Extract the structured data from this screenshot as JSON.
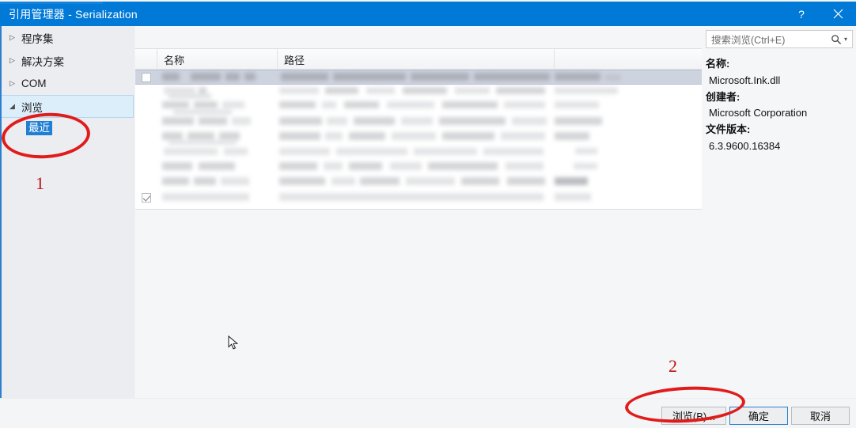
{
  "window": {
    "title": "引用管理器 - Serialization",
    "help_label": "?",
    "close_label": "✕"
  },
  "sidebar": {
    "items": [
      {
        "label": "程序集",
        "glyph": "▷",
        "expanded": false,
        "selected": false
      },
      {
        "label": "解决方案",
        "glyph": "▷",
        "expanded": false,
        "selected": false
      },
      {
        "label": "COM",
        "glyph": "▷",
        "expanded": false,
        "selected": false
      },
      {
        "label": "浏览",
        "glyph": "◢",
        "expanded": true,
        "selected": true
      }
    ],
    "child": {
      "label": "最近",
      "selected": true
    }
  },
  "list": {
    "columns": [
      {
        "key": "checkbox",
        "label": ""
      },
      {
        "key": "name",
        "label": "名称"
      },
      {
        "key": "path",
        "label": "路径"
      },
      {
        "key": "extra",
        "label": ""
      }
    ],
    "rows": [
      {
        "checked": false,
        "selected": true,
        "redacted": true
      },
      {
        "checked": false,
        "selected": false,
        "redacted": true
      },
      {
        "checked": false,
        "selected": false,
        "redacted": true
      },
      {
        "checked": false,
        "selected": false,
        "redacted": true
      },
      {
        "checked": false,
        "selected": false,
        "redacted": true
      },
      {
        "checked": false,
        "selected": false,
        "redacted": true
      },
      {
        "checked": false,
        "selected": false,
        "redacted": true
      },
      {
        "checked": false,
        "selected": false,
        "redacted": true
      },
      {
        "checked": true,
        "selected": false,
        "redacted": true
      }
    ]
  },
  "search": {
    "placeholder": "搜索浏览(Ctrl+E)",
    "icon": "search-icon",
    "dropdown_caret": "▾"
  },
  "details": {
    "name_label": "名称:",
    "name_value": "Microsoft.Ink.dll",
    "creator_label": "创建者:",
    "creator_value": "Microsoft Corporation",
    "version_label": "文件版本:",
    "version_value": "6.3.9600.16384"
  },
  "footer": {
    "browse_label": "浏览(B)...",
    "browse_accel": "B",
    "ok_label": "确定",
    "cancel_label": "取消"
  },
  "annotations": {
    "step1": "1",
    "step2": "2",
    "color": "#cc1111"
  },
  "colors": {
    "titlebar": "#0079d7",
    "accent": "#1f7fd4",
    "sidebar_bg": "#ebedf1",
    "content_bg": "#f5f6f7",
    "selection": "#ced3e0",
    "annotation_red": "#e11b1b"
  }
}
